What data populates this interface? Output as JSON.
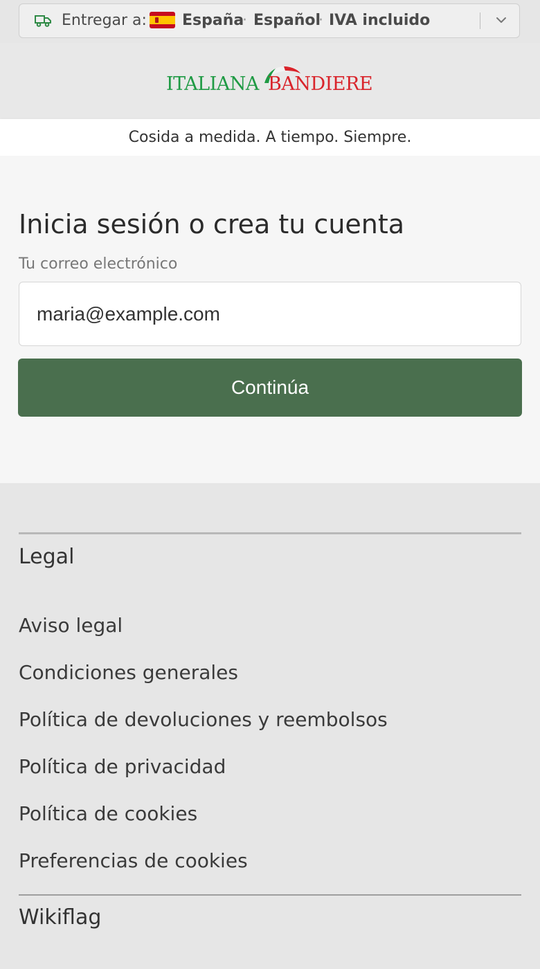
{
  "delivery": {
    "label": "Entregar a:",
    "country": "España",
    "separator": "·",
    "language": "Español",
    "vat": "IVA incluido"
  },
  "brand": {
    "logo_part1": "ITALIANA",
    "logo_part2": "BANDIERE",
    "tagline": "Cosida a medida. A tiempo. Siempre.",
    "colors": {
      "green": "#1f9a44",
      "red": "#d9242b"
    }
  },
  "login": {
    "title": "Inicia sesión o crea tu cuenta",
    "email_label": "Tu correo electrónico",
    "email_value": "maria@example.com",
    "continue_label": "Continúa",
    "button_color": "#4a6f4e"
  },
  "footer": {
    "legal_heading": "Legal",
    "legal_links": [
      "Aviso legal",
      "Condiciones generales",
      "Política de devoluciones y reembolsos",
      "Política de privacidad",
      "Política de cookies",
      "Preferencias de cookies"
    ],
    "wikiflag_heading": "Wikiflag"
  },
  "icons": {
    "delivery": "truck-icon",
    "country_flag": "spain-flag-icon",
    "dropdown": "chevron-down-icon"
  }
}
